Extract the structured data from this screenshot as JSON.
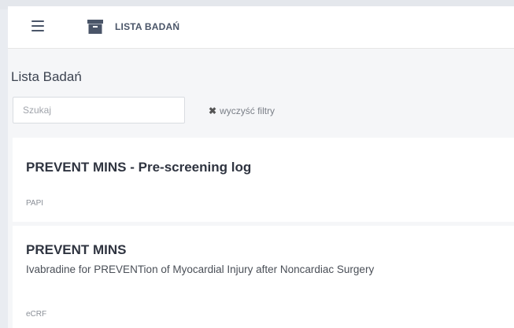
{
  "header": {
    "title": "LISTA BADAŃ",
    "menu_icon": "hamburger-icon",
    "section_icon": "archive-box-icon"
  },
  "main": {
    "page_title": "Lista Badań",
    "search": {
      "placeholder": "Szukaj",
      "value": ""
    },
    "clear_filters_label": "wyczyść filtry",
    "studies": [
      {
        "title": "PREVENT MINS - Pre-screening log",
        "description": "",
        "type": "PAPI"
      },
      {
        "title": "PREVENT MINS",
        "description": "Ivabradine for PREVENTion of Myocardial Injury after Noncardiac Surgery",
        "type": "eCRF"
      }
    ]
  },
  "colors": {
    "background": "#e9ecf1",
    "content_bg": "#f5f6f8",
    "icon": "#4a5568",
    "title_text": "#2f3440"
  }
}
